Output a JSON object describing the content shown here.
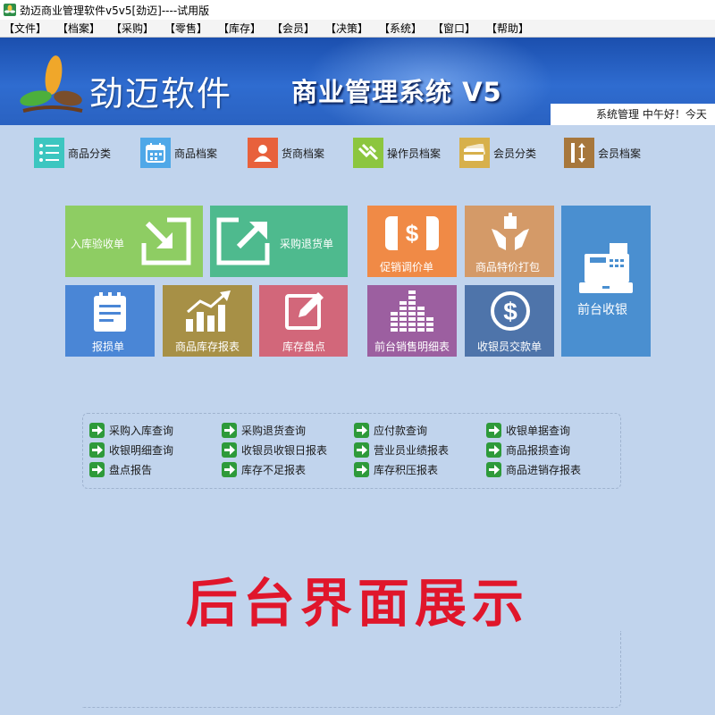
{
  "window": {
    "title": "劲迈商业管理软件v5v5[劲迈]----试用版"
  },
  "menu": [
    "【文件】",
    "【档案】",
    "【采购】",
    "【零售】",
    "【库存】",
    "【会员】",
    "【决策】",
    "【系统】",
    "【窗口】",
    "【帮助】"
  ],
  "banner": {
    "brand": "劲迈软件",
    "system_name": "商业管理系统 V5",
    "status": "系统管理  中午好！今天"
  },
  "quick_access": [
    {
      "label": "商品分类",
      "icon": "list-icon",
      "color": "#3cc6c0"
    },
    {
      "label": "商品档案",
      "icon": "calendar-icon",
      "color": "#4fa8e8"
    },
    {
      "label": "货商档案",
      "icon": "person-icon",
      "color": "#e8613c"
    },
    {
      "label": "操作员档案",
      "icon": "hand-icon",
      "color": "#8cc63f"
    },
    {
      "label": "会员分类",
      "icon": "card-icon",
      "color": "#d7b04b"
    },
    {
      "label": "会员档案",
      "icon": "vertical-arrows-icon",
      "color": "#a7773c"
    }
  ],
  "tiles": {
    "receiving": {
      "label": "入库验收单",
      "color": "#8ecd63"
    },
    "purchase_return": {
      "label": "采购退货单",
      "color": "#4eba8e"
    },
    "promo_price": {
      "label": "促销调价单",
      "color": "#f08a46"
    },
    "special_bundle": {
      "label": "商品特价打包",
      "color": "#d49a68"
    },
    "cashier": {
      "label": "前台收银",
      "color": "#4a8fd0"
    },
    "loss_report": {
      "label": "报损单",
      "color": "#4a86d6"
    },
    "stock_report": {
      "label": "商品库存报表",
      "color": "#a79046"
    },
    "stocktake": {
      "label": "库存盘点",
      "color": "#d2677a"
    },
    "sales_detail": {
      "label": "前台销售明细表",
      "color": "#9c5fa0"
    },
    "cashier_handover": {
      "label": "收银员交款单",
      "color": "#4e74aa"
    }
  },
  "reports": [
    "采购入库查询",
    "采购退货查询",
    "应付款查询",
    "收银单据查询",
    "收银明细查询",
    "收银员收银日报表",
    "营业员业绩报表",
    "商品报损查询",
    "盘点报告",
    "库存不足报表",
    "库存积压报表",
    "商品进销存报表"
  ],
  "overlay_caption": "后台界面展示"
}
